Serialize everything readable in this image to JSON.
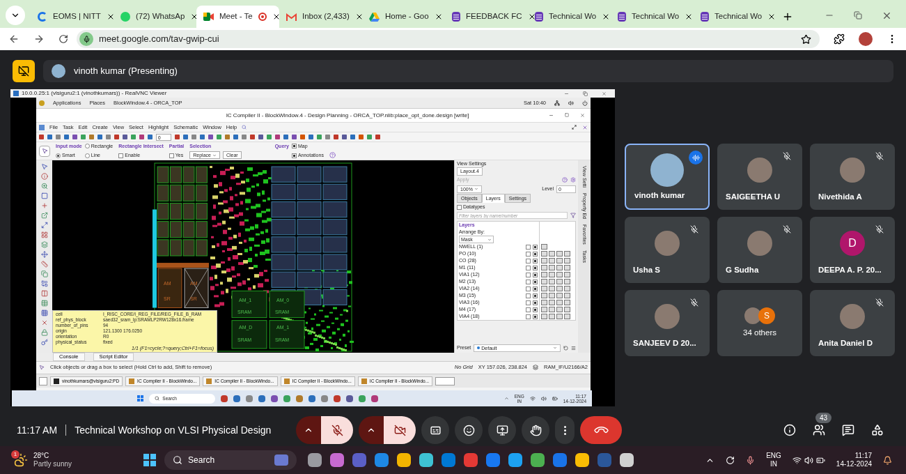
{
  "browser": {
    "tabs": [
      {
        "kind": "eoms",
        "title": "EOMS | NITT",
        "selected": false,
        "recording": false
      },
      {
        "kind": "whatsapp",
        "title": "(72) WhatsAp",
        "selected": false,
        "recording": false
      },
      {
        "kind": "meet",
        "title": "Meet - Te",
        "selected": true,
        "recording": true
      },
      {
        "kind": "gmail",
        "title": "Inbox (2,433)",
        "selected": false,
        "recording": false
      },
      {
        "kind": "drive",
        "title": "Home - Goo",
        "selected": false,
        "recording": false
      },
      {
        "kind": "forms",
        "title": "FEEDBACK FC",
        "selected": false,
        "recording": false
      },
      {
        "kind": "forms",
        "title": "Technical Wo",
        "selected": false,
        "recording": false
      },
      {
        "kind": "forms",
        "title": "Technical Wo",
        "selected": false,
        "recording": false
      },
      {
        "kind": "forms",
        "title": "Technical Wo",
        "selected": false,
        "recording": false
      }
    ],
    "address": "meet.google.com/tav-gwip-cui"
  },
  "presenter": "vinoth kumar (Presenting)",
  "shared_screen": {
    "vnc_title": "10.0.0.25:1 (vlsiguru2:1 (vinothkumars)) - RealVNC Viewer",
    "top_bar": {
      "menus": [
        "Applications",
        "Places",
        "BlockWindow.4 - ORCA_TOP"
      ],
      "clock": "Sat 10:40"
    },
    "app_title": "IC Compiler II - BlockWindow.4 - Design Planning - ORCA_TOP.nlib:place_opt_done.design [write]",
    "menu": [
      "File",
      "Task",
      "Edit",
      "Create",
      "View",
      "Select",
      "Highlight",
      "Schematic",
      "Window",
      "Help"
    ],
    "toolbar_value": "0",
    "options": {
      "input_mode_label": "Input mode",
      "input_modes": [
        {
          "label": "Rectangle",
          "selected": false
        },
        {
          "label": "Smart",
          "selected": true
        },
        {
          "label": "Line",
          "selected": false
        }
      ],
      "intersect_label": "Rectangle Intersect",
      "intersect": {
        "label": "Enable",
        "checked": false
      },
      "partial_label": "Partial",
      "partial": {
        "label": "Yes",
        "checked": false
      },
      "selection_label": "Selection",
      "selection": "Replace",
      "clear": "Clear",
      "query_label": "Query",
      "query": [
        {
          "label": "Map",
          "checked": true
        },
        {
          "label": "Annotations",
          "checked": true
        }
      ]
    },
    "layout_labels": [
      "AM",
      "SR",
      "AM",
      "SR",
      "AM_1",
      "SRAM",
      "AM_0",
      "SRAM",
      "AM_D",
      "SRAM",
      "AM_1",
      "SRAM"
    ],
    "tooltip": {
      "rows": [
        {
          "key": "cell",
          "value": "I_RISC_CORE/I_REG_FILE/REG_FILE_B_RAM"
        },
        {
          "key": "ref_phys_block",
          "value": "saed32_sram_lp:SRAMLP2RW128x16.frame"
        },
        {
          "key": "number_of_pins",
          "value": "94"
        },
        {
          "key": "origin",
          "value": "121.1300  176.0250"
        },
        {
          "key": "orientation",
          "value": "R0"
        },
        {
          "key": "physical_status",
          "value": "fixed"
        }
      ],
      "hint": "1/1 (F1=cycle;?=query;Ctrl+F1=focus)"
    },
    "view_settings": {
      "title": "View Settings",
      "layout_tab": "Layout.4",
      "apply": "Apply",
      "zoom": "100%",
      "level_label": "Level",
      "level": "0",
      "tabs": [
        {
          "label": "Objects",
          "selected": false
        },
        {
          "label": "Layers",
          "selected": true
        },
        {
          "label": "Settings",
          "selected": false
        }
      ],
      "datatypes": {
        "label": "Datatypes",
        "checked": false
      },
      "filter_placeholder": "Filter layers by name/number",
      "layers_title": "Layers",
      "arrange_label": "Arrange By:",
      "arrange": "Mask",
      "layers": [
        {
          "name": "NWELL (1)",
          "check_1": false,
          "check_2": true
        },
        {
          "name": "PO (10)",
          "check_1": false,
          "check_2": true
        },
        {
          "name": "CO (28)",
          "check_1": false,
          "check_2": true
        },
        {
          "name": "M1 (11)",
          "check_1": false,
          "check_2": true
        },
        {
          "name": "VIA1 (12)",
          "check_1": false,
          "check_2": true
        },
        {
          "name": "M2 (13)",
          "check_1": false,
          "check_2": true
        },
        {
          "name": "VIA2 (14)",
          "check_1": false,
          "check_2": true
        },
        {
          "name": "M3 (15)",
          "check_1": false,
          "check_2": true
        },
        {
          "name": "VIA3 (16)",
          "check_1": false,
          "check_2": true
        },
        {
          "name": "M4 (17)",
          "check_1": false,
          "check_2": true
        },
        {
          "name": "VIA4 (18)",
          "check_1": false,
          "check_2": true
        }
      ],
      "preset_label": "Preset",
      "preset": "Default"
    },
    "side_tabs": [
      "View Setti",
      "Property Ed",
      "Favorites",
      "Tasks"
    ],
    "console_tabs": [
      "Console",
      "Script Editor"
    ],
    "status": {
      "message": "Click objects or drag a box to select (Hold Ctrl to add, Shift to remove)",
      "grid": "No Grid",
      "xy": "XY 157.026, 238.824",
      "object": "RAM_IF/U2166/A2"
    },
    "gnome_tasks": [
      "vinothkumars@vlsiguru2:PD",
      "IC Compiler II - BlockWindo...",
      "IC Compiler II - BlockWindo...",
      "IC Compiler II - BlockWindo...",
      "IC Compiler II - BlockWindo..."
    ],
    "win_taskbar": {
      "search": "Search",
      "lang": "ENG",
      "region": "IN",
      "time": "11:17",
      "date": "14-12-2024"
    }
  },
  "participants": [
    {
      "kind": "photo",
      "name": "vinoth kumar",
      "speaking": true,
      "muted": false
    },
    {
      "kind": "photo",
      "name": "SAIGEETHA U",
      "speaking": false,
      "muted": true
    },
    {
      "kind": "photo",
      "name": "Nivethida A",
      "speaking": false,
      "muted": true
    },
    {
      "kind": "photo",
      "name": "Usha S",
      "speaking": false,
      "muted": true
    },
    {
      "kind": "photo",
      "name": "G Sudha",
      "speaking": false,
      "muted": true
    },
    {
      "kind": "letter",
      "name": "DEEPA A. P. 20...",
      "letter": "D",
      "color": "#b0166b",
      "speaking": false,
      "muted": true
    },
    {
      "kind": "photo",
      "name": "SANJEEV D 20...",
      "speaking": false,
      "muted": true
    },
    {
      "kind": "group",
      "name": "34 others",
      "letter": "S",
      "color": "#e8710a",
      "speaking": false,
      "muted": false
    },
    {
      "kind": "photo",
      "name": "Anita Daniel D",
      "speaking": false,
      "muted": true
    }
  ],
  "meeting": {
    "time": "11:17 AM",
    "title": "Technical Workshop on VLSI Physical Design",
    "mic_muted": true,
    "camera_off": true,
    "people_count": "43"
  },
  "taskbar": {
    "weather_badge": "1",
    "temperature": "28°C",
    "condition": "Partly sunny",
    "search": "Search",
    "lang": "ENG",
    "region": "IN",
    "time": "11:17",
    "date": "14-12-2024"
  }
}
